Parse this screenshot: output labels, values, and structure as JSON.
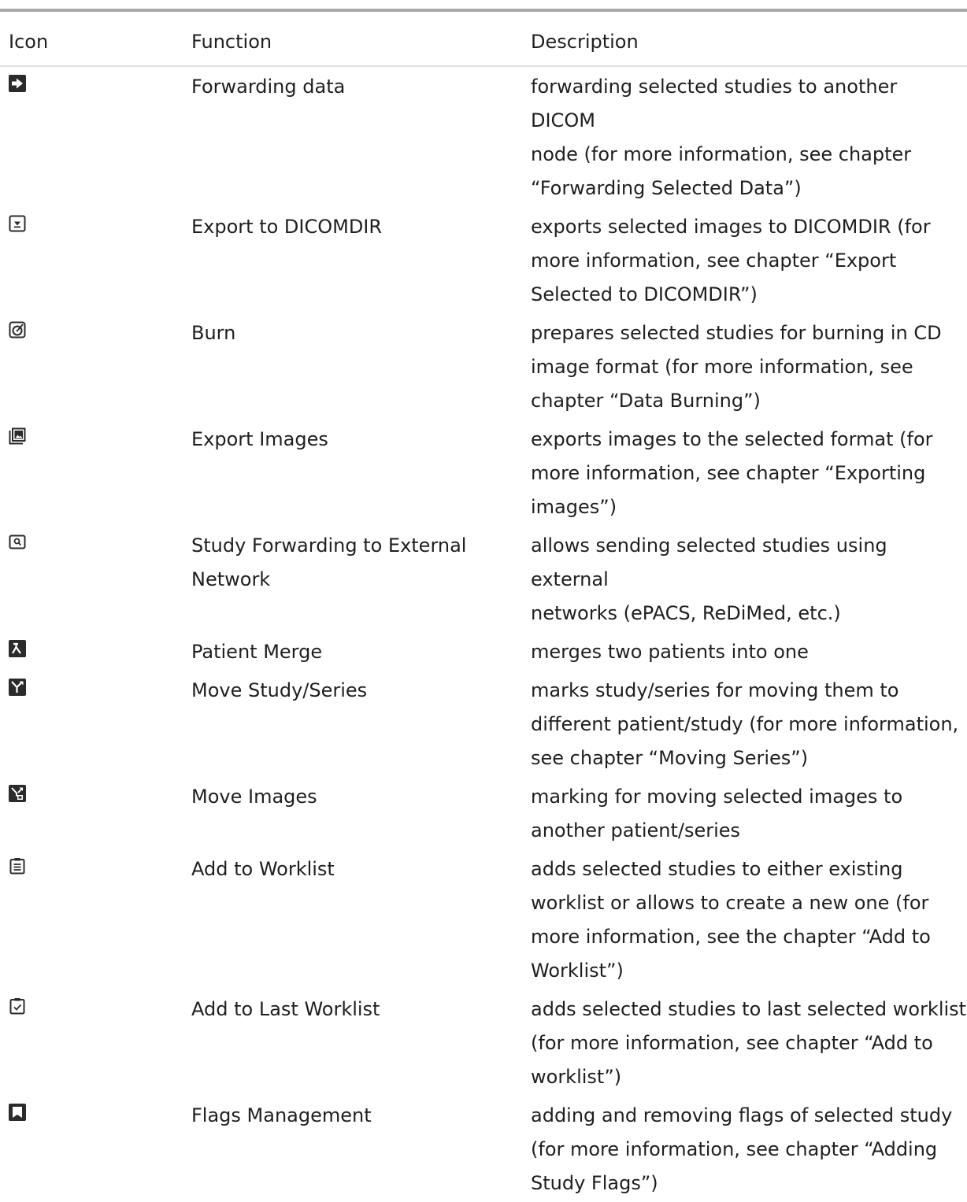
{
  "table": {
    "headers": {
      "icon": "Icon",
      "function": "Function",
      "description": "Description"
    },
    "rows": [
      {
        "icon": "forward-arrow-icon",
        "function": "Forwarding data",
        "description": "forwarding selected studies to another DICOM\nnode (for more information, see chapter\n“Forwarding Selected Data”)"
      },
      {
        "icon": "export-dicomdir-icon",
        "function": "Export to DICOMDIR",
        "description": "exports selected images to DICOMDIR (for\nmore information, see chapter “Export\nSelected to DICOMDIR”)"
      },
      {
        "icon": "burn-disc-icon",
        "function": "Burn",
        "description": "prepares selected studies for burning in CD\nimage format (for more information, see\nchapter “Data Burning”)"
      },
      {
        "icon": "export-images-icon",
        "function": "Export Images",
        "description": "exports images to the selected format (for\nmore information, see chapter “Exporting\nimages”)"
      },
      {
        "icon": "external-network-icon",
        "function": "Study Forwarding to External\nNetwork",
        "description": "allows sending selected studies using external\nnetworks (ePACS, ReDiMed, etc.)"
      },
      {
        "icon": "patient-merge-icon",
        "function": "Patient Merge",
        "description": "merges two patients into one"
      },
      {
        "icon": "move-study-series-icon",
        "function": "Move Study/Series",
        "description": "marks study/series for moving them to\ndifferent patient/study (for more information,\nsee chapter “Moving Series”)"
      },
      {
        "icon": "move-images-icon",
        "function": "Move Images",
        "description": "marking for moving selected images to\nanother patient/series"
      },
      {
        "icon": "add-worklist-icon",
        "function": "Add to Worklist",
        "description": "adds selected studies to either existing\nworklist or allows to create a new one (for\nmore information, see the chapter “Add to\nWorklist”)"
      },
      {
        "icon": "add-last-worklist-icon",
        "function": "Add to Last Worklist",
        "description": "adds selected studies to last selected worklist\n(for more information, see chapter “Add to\nworklist”)"
      },
      {
        "icon": "flag-icon",
        "function": "Flags Management",
        "description": "adding and removing flags of selected study\n(for more information, see chapter “Adding\nStudy Flags”)"
      }
    ]
  }
}
